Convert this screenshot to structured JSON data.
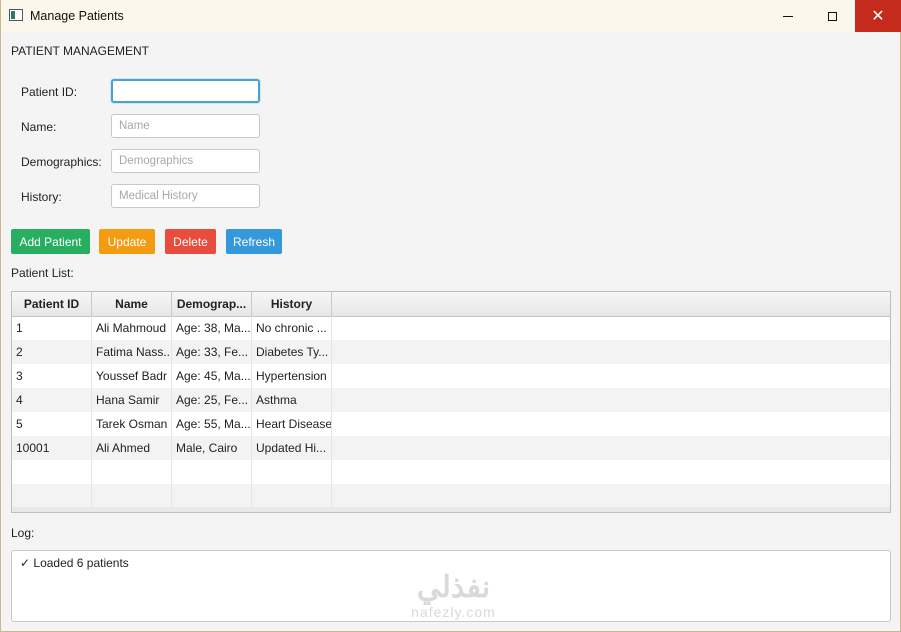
{
  "window": {
    "title": "Manage Patients"
  },
  "form": {
    "section_title": "PATIENT MANAGEMENT",
    "patient_id": {
      "label": "Patient ID:",
      "value": "",
      "placeholder": ""
    },
    "name": {
      "label": "Name:",
      "placeholder": "Name"
    },
    "demographics": {
      "label": "Demographics:",
      "placeholder": "Demographics"
    },
    "history": {
      "label": "History:",
      "placeholder": "Medical History"
    }
  },
  "buttons": {
    "add": "Add Patient",
    "update": "Update",
    "delete": "Delete",
    "refresh": "Refresh"
  },
  "buttons_colors": {
    "add": "#27ae60",
    "update": "#f39c12",
    "delete": "#e74c3c",
    "refresh": "#3498db"
  },
  "table": {
    "label": "Patient List:",
    "columns": [
      "Patient ID",
      "Name",
      "Demograp...",
      "History"
    ],
    "rows": [
      [
        "1",
        "Ali Mahmoud",
        "Age: 38, Ma...",
        "No chronic ..."
      ],
      [
        "2",
        "Fatima Nass...",
        "Age: 33, Fe...",
        "Diabetes Ty..."
      ],
      [
        "3",
        "Youssef Badr",
        "Age: 45, Ma...",
        "Hypertension"
      ],
      [
        "4",
        "Hana Samir",
        "Age: 25, Fe...",
        "Asthma"
      ],
      [
        "5",
        "Tarek Osman",
        "Age: 55, Ma...",
        "Heart Disease"
      ],
      [
        "10001",
        "Ali Ahmed",
        "Male, Cairo",
        "Updated Hi..."
      ]
    ]
  },
  "log": {
    "label": "Log:",
    "entries": [
      "✓ Loaded 6 patients"
    ]
  },
  "watermark": {
    "arabic": "نفذلي",
    "latin": "nafezly.com"
  }
}
